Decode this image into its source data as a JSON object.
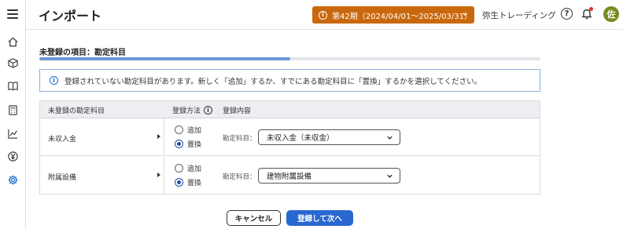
{
  "header": {
    "title": "インポート",
    "period": "第42期（2024/04/01〜2025/03/31）",
    "company": "弥生トレーディング",
    "avatar": "佐",
    "colors": {
      "period_bg": "#c9680c",
      "avatar_bg": "#7a8a1e",
      "accent": "#2967d1"
    }
  },
  "sidebar": {
    "icons": [
      "menu-icon",
      "home-icon",
      "box-icon",
      "book-icon",
      "calculator-icon",
      "chart-icon",
      "yen-icon",
      "gear-icon"
    ],
    "active": "gear-icon"
  },
  "section": {
    "title": "未登録の項目：勘定科目",
    "progress": 0.5
  },
  "notice": {
    "text": "登録されていない勘定科目があります。新しく「追加」するか、すでにある勘定科目に「置換」するかを選択してください。"
  },
  "table": {
    "headers": {
      "account": "未登録の勘定科目",
      "method": "登録方法",
      "content": "登録内容"
    },
    "rows": [
      {
        "name": "未収入金",
        "option_add": "追加",
        "option_replace": "置換",
        "selected": "置換",
        "field_label": "勘定科目：",
        "value": "未収入金（未収金）"
      },
      {
        "name": "附属設備",
        "option_add": "追加",
        "option_replace": "置換",
        "selected": "置換",
        "field_label": "勘定科目：",
        "value": "建物附属設備"
      }
    ]
  },
  "buttons": {
    "cancel": "キャンセル",
    "next": "登録して次へ"
  }
}
